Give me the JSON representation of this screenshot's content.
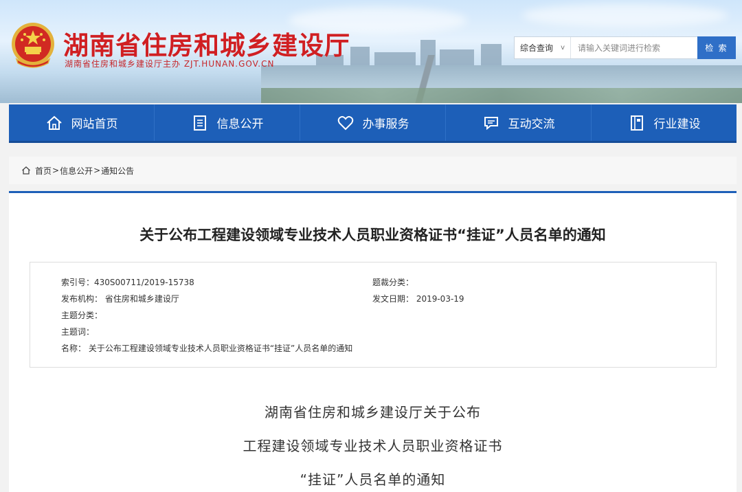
{
  "header": {
    "site_title": "湖南省住房和城乡建设厅",
    "site_subtitle": "湖南省住房和城乡建设厅主办  ZJT.HUNAN.GOV.CN",
    "search": {
      "scope_selected": "综合查询",
      "scope_chevron": "v",
      "placeholder": "请输入关键词进行检索",
      "button_label": "检 索"
    }
  },
  "nav": {
    "items": [
      {
        "label": "网站首页",
        "icon": "home-icon"
      },
      {
        "label": "信息公开",
        "icon": "document-icon"
      },
      {
        "label": "办事服务",
        "icon": "heart-icon"
      },
      {
        "label": "互动交流",
        "icon": "chat-icon"
      },
      {
        "label": "行业建设",
        "icon": "book-icon"
      }
    ]
  },
  "breadcrumb": {
    "home": "首页",
    "sep": ">",
    "level1": "信息公开",
    "level2": "通知公告"
  },
  "article": {
    "title": "关于公布工程建设领域专业技术人员职业资格证书“挂证”人员名单的通知",
    "meta": {
      "index_no": "索引号：430S00711/2019-15738",
      "genre": "题裁分类：",
      "publisher": "发布机构：  省住房和城乡建设厅",
      "date": "发文日期：  2019-03-19",
      "topic_category": "主题分类：",
      "subject_words": "主题词：",
      "name": "名称：  关于公布工程建设领域专业技术人员职业资格证书“挂证”人员名单的通知"
    },
    "body_lines": [
      "湖南省住房和城乡建设厅关于公布",
      "工程建设领域专业技术人员职业资格证书",
      "“挂证”人员名单的通知"
    ]
  },
  "colors": {
    "brand_red": "#d01f22",
    "nav_blue": "#1d5fb8",
    "search_button": "#2f6fc7"
  }
}
